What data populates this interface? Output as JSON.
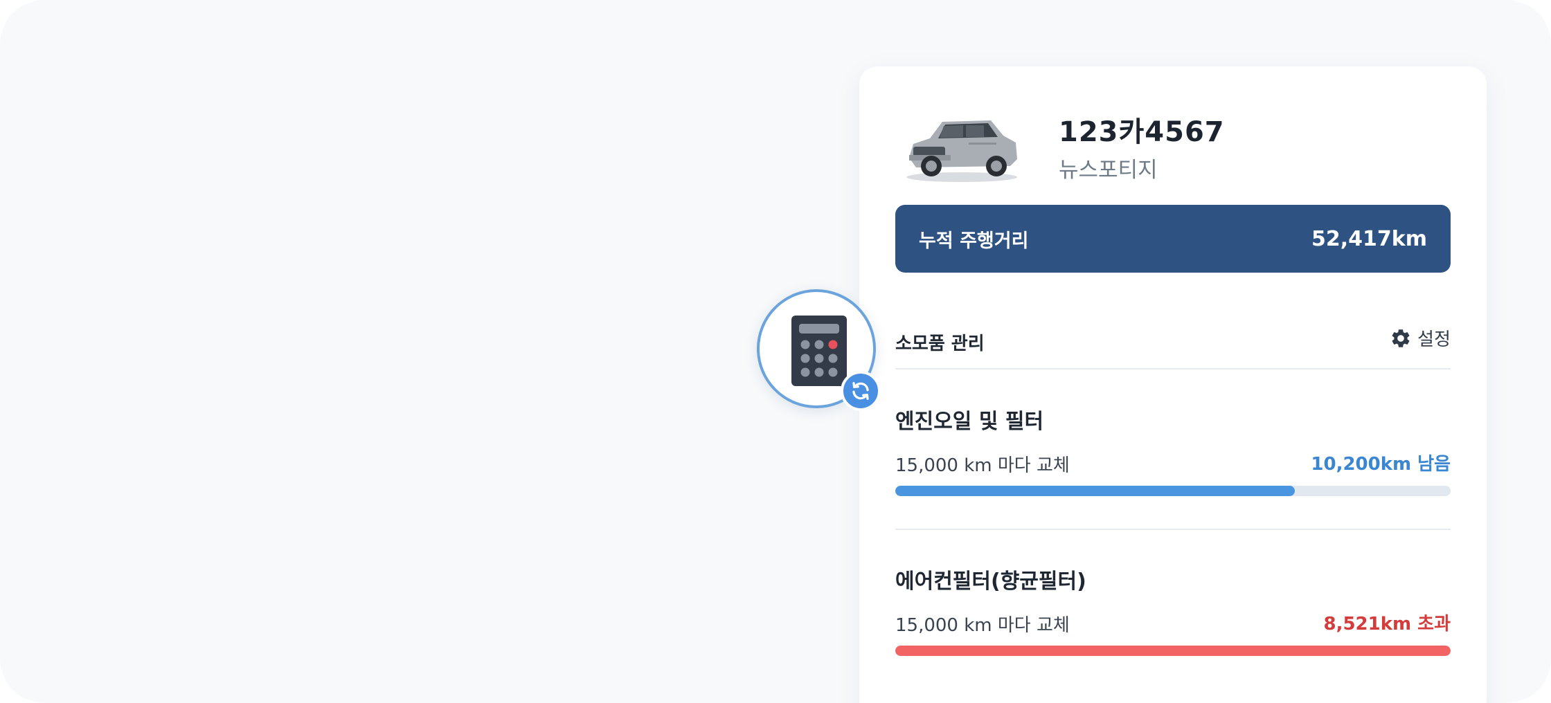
{
  "vehicle": {
    "plate": "123카4567",
    "model": "뉴스포티지",
    "image": "suv-car-image"
  },
  "mileage": {
    "label": "누적 주행거리",
    "value": "52,417km"
  },
  "consumables": {
    "title": "소모품 관리",
    "settings_label": "설정",
    "settings_icon": "gear-icon",
    "items": [
      {
        "name": "엔진오일 및 필터",
        "interval": "15,000 km 마다 교체",
        "status": "10,200km 남음",
        "status_color": "#3b86d1",
        "bar_color": "#4a95df",
        "progress": 0.72
      },
      {
        "name": "에어컨필터(향균필터)",
        "interval": "15,000 km 마다 교체",
        "status": "8,521km 초과",
        "status_color": "#d43c3c",
        "bar_color": "#f26464",
        "progress": 1.0
      }
    ]
  },
  "calculator_badge": {
    "icon": "calculator-icon",
    "sub_icon": "refresh-icon",
    "accent": "#4a90e2"
  }
}
